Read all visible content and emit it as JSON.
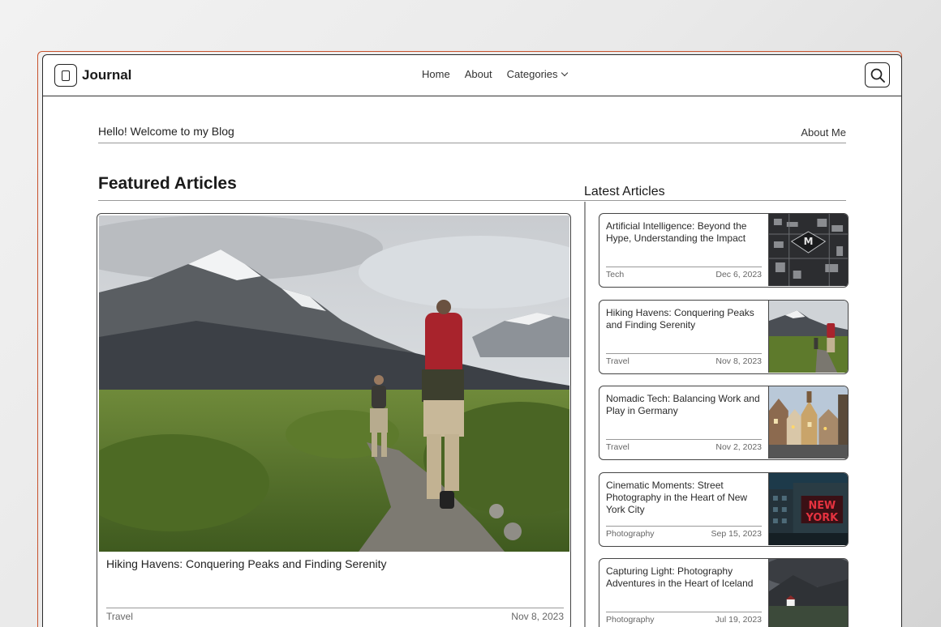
{
  "brand": {
    "name": "Journal"
  },
  "nav": {
    "home": "Home",
    "about": "About",
    "categories": "Categories"
  },
  "welcome": {
    "text": "Hello! Welcome to my Blog",
    "about_me": "About Me"
  },
  "featured": {
    "heading": "Featured Articles",
    "article": {
      "title": "Hiking Havens: Conquering Peaks and Finding Serenity",
      "category": "Travel",
      "date": "Nov 8, 2023",
      "image": "hikers-mountains-image"
    }
  },
  "latest": {
    "heading": "Latest Articles",
    "articles": [
      {
        "title": "Artificial Intelligence: Beyond the Hype, Understanding the Impact",
        "category": "Tech",
        "date": "Dec 6, 2023",
        "image": "circuit-chip-image"
      },
      {
        "title": "Hiking Havens: Conquering Peaks and Finding Serenity",
        "category": "Travel",
        "date": "Nov 8, 2023",
        "image": "hikers-mountains-image"
      },
      {
        "title": "Nomadic Tech: Balancing Work and Play in Germany",
        "category": "Travel",
        "date": "Nov 2, 2023",
        "image": "german-town-street-image"
      },
      {
        "title": "Cinematic Moments: Street Photography in the Heart of New York City",
        "category": "Photography",
        "date": "Sep 15, 2023",
        "image": "new-york-sign-image"
      },
      {
        "title": "Capturing Light: Photography Adventures in the Heart of Iceland",
        "category": "Photography",
        "date": "Jul 19, 2023",
        "image": "iceland-landscape-image"
      }
    ]
  }
}
